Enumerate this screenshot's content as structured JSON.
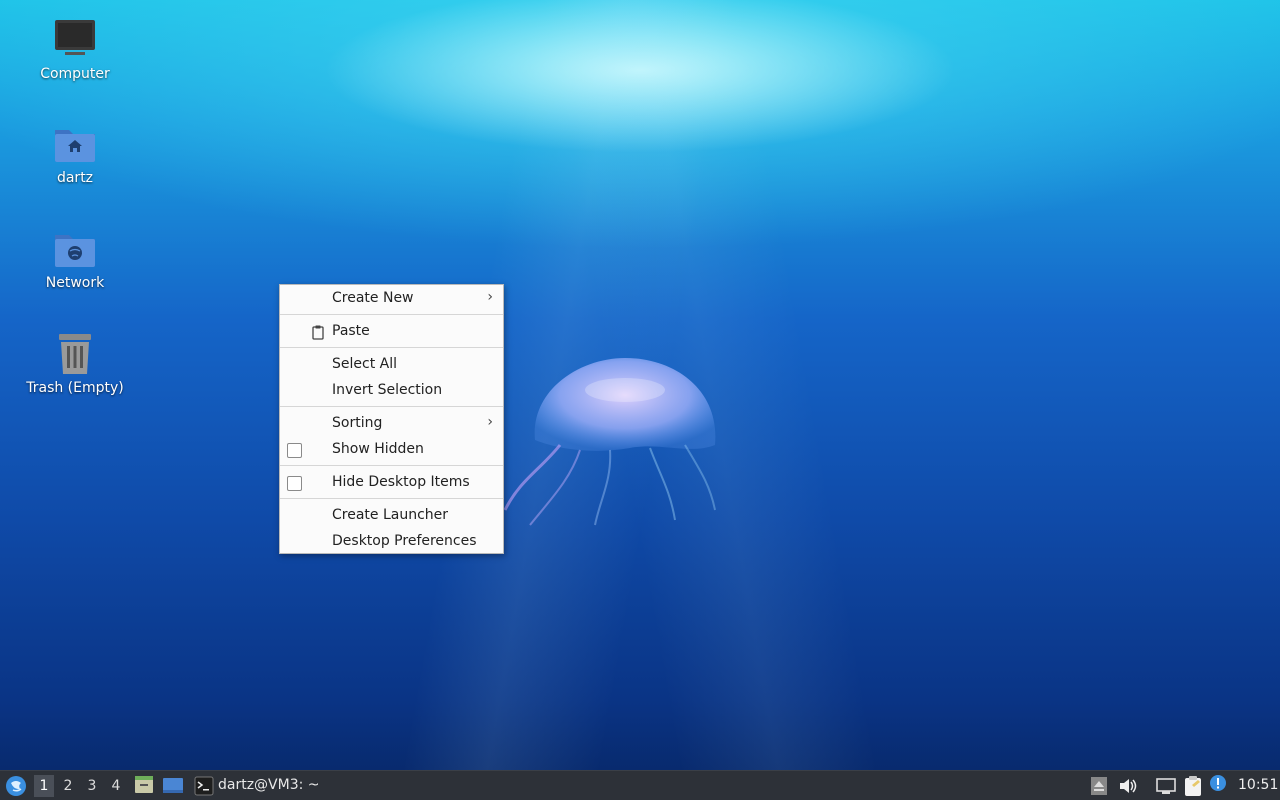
{
  "desktop": {
    "icons": [
      {
        "label": "Computer",
        "icon": "computer-icon"
      },
      {
        "label": "dartz",
        "icon": "home-folder-icon"
      },
      {
        "label": "Network",
        "icon": "network-folder-icon"
      },
      {
        "label": "Trash (Empty)",
        "icon": "trash-icon"
      }
    ]
  },
  "context_menu": {
    "items": [
      {
        "label": "Create New",
        "submenu": true
      },
      {
        "label": "Paste",
        "icon": "clipboard-icon"
      },
      {
        "label": "Select All"
      },
      {
        "label": "Invert Selection"
      },
      {
        "label": "Sorting",
        "submenu": true
      },
      {
        "label": "Show Hidden",
        "checkbox": true,
        "checked": false
      },
      {
        "label": "Hide Desktop Items",
        "checkbox": true,
        "checked": false
      },
      {
        "label": "Create Launcher"
      },
      {
        "label": "Desktop Preferences"
      }
    ]
  },
  "taskbar": {
    "menu_icon": "lxqt-logo-icon",
    "workspaces": [
      "1",
      "2",
      "3",
      "4"
    ],
    "active_workspace": "1",
    "quicklaunch": [
      "file-manager-icon",
      "show-desktop-icon"
    ],
    "task": {
      "label": "dartz@VM3: ~",
      "icon": "terminal-icon"
    },
    "tray": [
      "eject-icon",
      "volume-icon",
      "network-icon",
      "clipboard-icon",
      "update-notifier-icon"
    ],
    "clock": "10:51"
  },
  "colors": {
    "taskbar_bg": "#2d3138",
    "menu_bg": "#fbfbfb",
    "folder_blue": "#4a86d4"
  }
}
